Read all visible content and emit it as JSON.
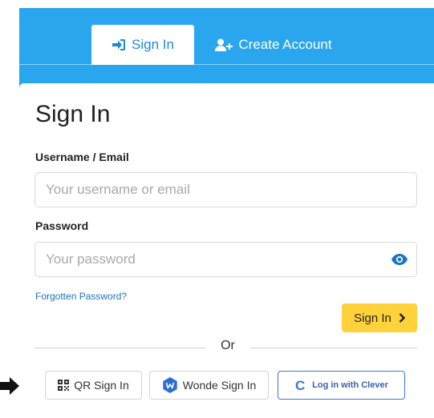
{
  "tabs": {
    "signin_label": "Sign In",
    "create_label": "Create Account"
  },
  "form": {
    "title": "Sign In",
    "username_label": "Username / Email",
    "username_placeholder": "Your username or email",
    "password_label": "Password",
    "password_placeholder": "Your password",
    "forgot_label": "Forgotten Password?",
    "submit_label": "Sign In",
    "divider_text": "Or"
  },
  "sso": {
    "qr_label": "QR Sign In",
    "wonde_label": "Wonde Sign In",
    "clever_label": "Log in with Clever",
    "clever_logo_letter": "C"
  },
  "icons": {
    "signin_tab": "sign-in-icon",
    "create_tab": "user-plus-icon",
    "password_toggle": "eye-icon",
    "submit": "chevron-right-icon",
    "qr": "qr-code-icon",
    "wonde": "wonde-logo-icon",
    "clever": "clever-logo-icon",
    "pointer": "arrow-icon"
  },
  "colors": {
    "panel_blue": "#29a6ee",
    "link_blue": "#1e73be",
    "button_yellow": "#ffd23c",
    "clever_blue": "#3d74d8"
  }
}
